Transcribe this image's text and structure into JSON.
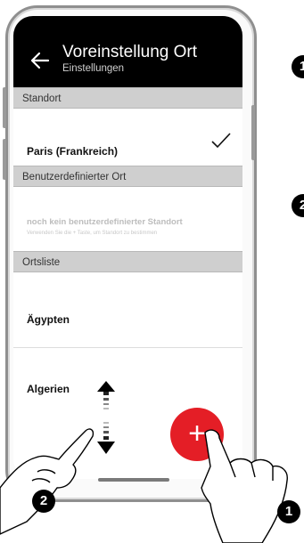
{
  "header": {
    "title": "Voreinstellung Ort",
    "subtitle": "Einstellungen"
  },
  "sections": {
    "standort": "Standort",
    "custom": "Benutzerdefinierter Ort",
    "list": "Ortsliste"
  },
  "standort_row": {
    "value": "Paris (Frankreich)"
  },
  "custom_row": {
    "title": "noch kein benutzerdefinierter Standort",
    "hint": "Verwenden Sie die + Taste, um Standort zu bestimmen"
  },
  "list_items": [
    "Ägypten",
    "Algerien"
  ],
  "fab_symbol": "+",
  "badges": {
    "right_top": "1",
    "right_bottom": "2",
    "bottom_left": "2",
    "bottom_right": "1"
  },
  "colors": {
    "header_bg": "#000000",
    "section_bg": "#cfcfcf",
    "accent_red": "#e41e26"
  },
  "icons": [
    "back-arrow-icon",
    "checkmark-icon",
    "plus-icon",
    "scroll-arrows-icon",
    "hand-pointer-icon"
  ]
}
